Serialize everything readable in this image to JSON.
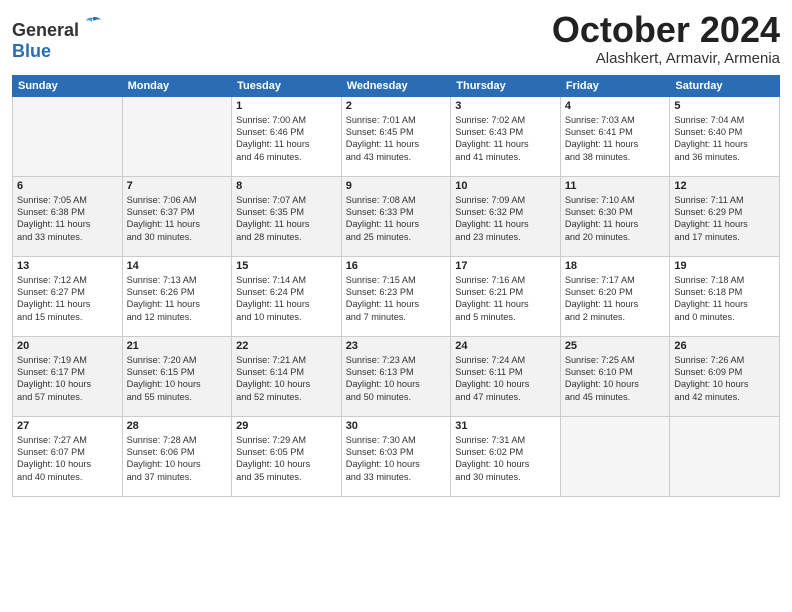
{
  "header": {
    "logo_line1": "General",
    "logo_line2": "Blue",
    "month": "October 2024",
    "location": "Alashkert, Armavir, Armenia"
  },
  "days_of_week": [
    "Sunday",
    "Monday",
    "Tuesday",
    "Wednesday",
    "Thursday",
    "Friday",
    "Saturday"
  ],
  "weeks": [
    [
      {
        "num": "",
        "info": ""
      },
      {
        "num": "",
        "info": ""
      },
      {
        "num": "1",
        "info": "Sunrise: 7:00 AM\nSunset: 6:46 PM\nDaylight: 11 hours\nand 46 minutes."
      },
      {
        "num": "2",
        "info": "Sunrise: 7:01 AM\nSunset: 6:45 PM\nDaylight: 11 hours\nand 43 minutes."
      },
      {
        "num": "3",
        "info": "Sunrise: 7:02 AM\nSunset: 6:43 PM\nDaylight: 11 hours\nand 41 minutes."
      },
      {
        "num": "4",
        "info": "Sunrise: 7:03 AM\nSunset: 6:41 PM\nDaylight: 11 hours\nand 38 minutes."
      },
      {
        "num": "5",
        "info": "Sunrise: 7:04 AM\nSunset: 6:40 PM\nDaylight: 11 hours\nand 36 minutes."
      }
    ],
    [
      {
        "num": "6",
        "info": "Sunrise: 7:05 AM\nSunset: 6:38 PM\nDaylight: 11 hours\nand 33 minutes."
      },
      {
        "num": "7",
        "info": "Sunrise: 7:06 AM\nSunset: 6:37 PM\nDaylight: 11 hours\nand 30 minutes."
      },
      {
        "num": "8",
        "info": "Sunrise: 7:07 AM\nSunset: 6:35 PM\nDaylight: 11 hours\nand 28 minutes."
      },
      {
        "num": "9",
        "info": "Sunrise: 7:08 AM\nSunset: 6:33 PM\nDaylight: 11 hours\nand 25 minutes."
      },
      {
        "num": "10",
        "info": "Sunrise: 7:09 AM\nSunset: 6:32 PM\nDaylight: 11 hours\nand 23 minutes."
      },
      {
        "num": "11",
        "info": "Sunrise: 7:10 AM\nSunset: 6:30 PM\nDaylight: 11 hours\nand 20 minutes."
      },
      {
        "num": "12",
        "info": "Sunrise: 7:11 AM\nSunset: 6:29 PM\nDaylight: 11 hours\nand 17 minutes."
      }
    ],
    [
      {
        "num": "13",
        "info": "Sunrise: 7:12 AM\nSunset: 6:27 PM\nDaylight: 11 hours\nand 15 minutes."
      },
      {
        "num": "14",
        "info": "Sunrise: 7:13 AM\nSunset: 6:26 PM\nDaylight: 11 hours\nand 12 minutes."
      },
      {
        "num": "15",
        "info": "Sunrise: 7:14 AM\nSunset: 6:24 PM\nDaylight: 11 hours\nand 10 minutes."
      },
      {
        "num": "16",
        "info": "Sunrise: 7:15 AM\nSunset: 6:23 PM\nDaylight: 11 hours\nand 7 minutes."
      },
      {
        "num": "17",
        "info": "Sunrise: 7:16 AM\nSunset: 6:21 PM\nDaylight: 11 hours\nand 5 minutes."
      },
      {
        "num": "18",
        "info": "Sunrise: 7:17 AM\nSunset: 6:20 PM\nDaylight: 11 hours\nand 2 minutes."
      },
      {
        "num": "19",
        "info": "Sunrise: 7:18 AM\nSunset: 6:18 PM\nDaylight: 11 hours\nand 0 minutes."
      }
    ],
    [
      {
        "num": "20",
        "info": "Sunrise: 7:19 AM\nSunset: 6:17 PM\nDaylight: 10 hours\nand 57 minutes."
      },
      {
        "num": "21",
        "info": "Sunrise: 7:20 AM\nSunset: 6:15 PM\nDaylight: 10 hours\nand 55 minutes."
      },
      {
        "num": "22",
        "info": "Sunrise: 7:21 AM\nSunset: 6:14 PM\nDaylight: 10 hours\nand 52 minutes."
      },
      {
        "num": "23",
        "info": "Sunrise: 7:23 AM\nSunset: 6:13 PM\nDaylight: 10 hours\nand 50 minutes."
      },
      {
        "num": "24",
        "info": "Sunrise: 7:24 AM\nSunset: 6:11 PM\nDaylight: 10 hours\nand 47 minutes."
      },
      {
        "num": "25",
        "info": "Sunrise: 7:25 AM\nSunset: 6:10 PM\nDaylight: 10 hours\nand 45 minutes."
      },
      {
        "num": "26",
        "info": "Sunrise: 7:26 AM\nSunset: 6:09 PM\nDaylight: 10 hours\nand 42 minutes."
      }
    ],
    [
      {
        "num": "27",
        "info": "Sunrise: 7:27 AM\nSunset: 6:07 PM\nDaylight: 10 hours\nand 40 minutes."
      },
      {
        "num": "28",
        "info": "Sunrise: 7:28 AM\nSunset: 6:06 PM\nDaylight: 10 hours\nand 37 minutes."
      },
      {
        "num": "29",
        "info": "Sunrise: 7:29 AM\nSunset: 6:05 PM\nDaylight: 10 hours\nand 35 minutes."
      },
      {
        "num": "30",
        "info": "Sunrise: 7:30 AM\nSunset: 6:03 PM\nDaylight: 10 hours\nand 33 minutes."
      },
      {
        "num": "31",
        "info": "Sunrise: 7:31 AM\nSunset: 6:02 PM\nDaylight: 10 hours\nand 30 minutes."
      },
      {
        "num": "",
        "info": ""
      },
      {
        "num": "",
        "info": ""
      }
    ]
  ]
}
